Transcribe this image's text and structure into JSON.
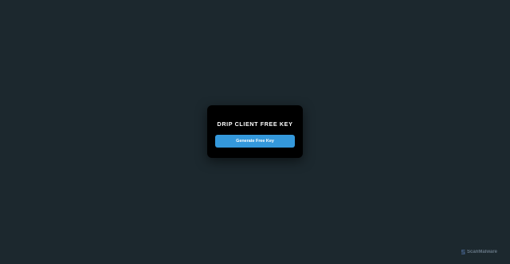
{
  "card": {
    "title": "DRIP CLIENT FREE KEY",
    "button_label": "Generate Free Key"
  },
  "watermark": {
    "icon": "scanmalware-logo-icon",
    "text": "ScanMalware"
  },
  "colors": {
    "background": "#1c282e",
    "card": "#000000",
    "button": "#3498db"
  }
}
